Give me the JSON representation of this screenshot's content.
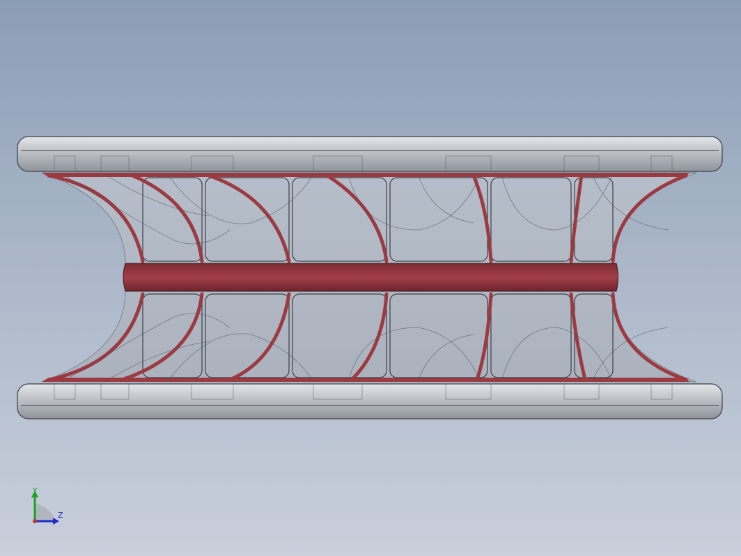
{
  "viewport": {
    "background": "#a9b6c8"
  },
  "model": {
    "body_color": "#b8bcc2",
    "section_color": "#9c3a42",
    "edge_color": "#3c3f44"
  },
  "triad": {
    "y_label": "Y",
    "z_label": "Z",
    "y_color": "#19a31c",
    "z_color": "#1c2fc8"
  }
}
